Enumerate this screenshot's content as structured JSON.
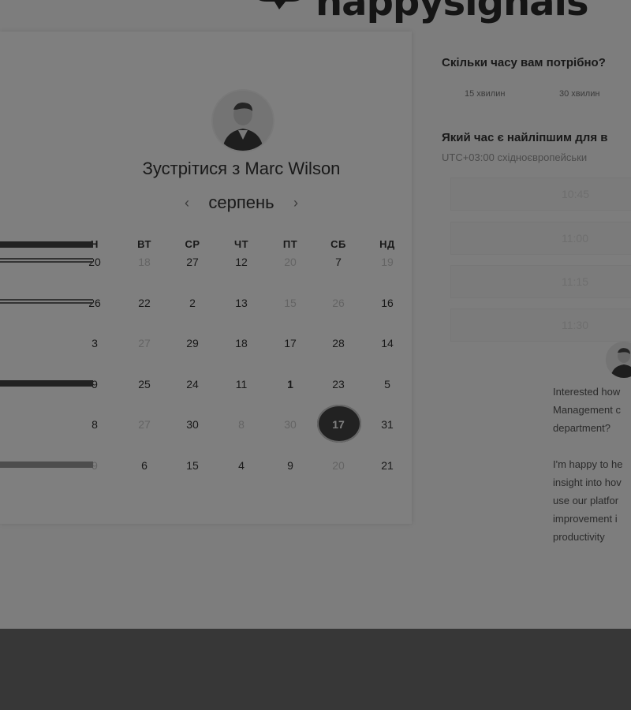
{
  "logo": {
    "text": "happysignals"
  },
  "calendar": {
    "title": "Зустрітися з Marc Wilson",
    "month": "серпень",
    "prev_icon": "chevron-left-icon",
    "next_icon": "chevron-right-icon",
    "weekdays": [
      "Н",
      "ВТ",
      "СР",
      "ЧТ",
      "ПТ",
      "СБ",
      "НД"
    ],
    "rows": [
      [
        "20",
        "18",
        "27",
        "12",
        "20",
        "7",
        "19"
      ],
      [
        "26",
        "22",
        "2",
        "13",
        "15",
        "26",
        "16"
      ],
      [
        "3",
        "27",
        "29",
        "18",
        "17",
        "28",
        "14"
      ],
      [
        "9",
        "25",
        "24",
        "11",
        "1",
        "23",
        "5"
      ],
      [
        "8",
        "27",
        "30",
        "8",
        "30",
        "17",
        "31"
      ],
      [
        "9",
        "6",
        "15",
        "4",
        "9",
        "20",
        "21"
      ]
    ],
    "selected_day": "17"
  },
  "scheduler": {
    "duration_question": "Скільки часу вам потрібно?",
    "durations": [
      "15 хвилин",
      "30 хвилин"
    ],
    "time_question": "Який час є найліпшим для в",
    "timezone": "UTC+03:00 східноєвропейськи",
    "slots": [
      "10:45",
      "11:00",
      "11:15",
      "11:30"
    ],
    "description": [
      "Interested how",
      "Management c",
      "department?",
      "",
      "I'm happy to he",
      "insight into hov",
      "use our platfor",
      "improvement i",
      "productivity"
    ]
  },
  "colors": {
    "overlay": "rgba(0,0,0,0.5)",
    "selected_day": "#444444",
    "bottom_band": "#6f6f6f"
  }
}
